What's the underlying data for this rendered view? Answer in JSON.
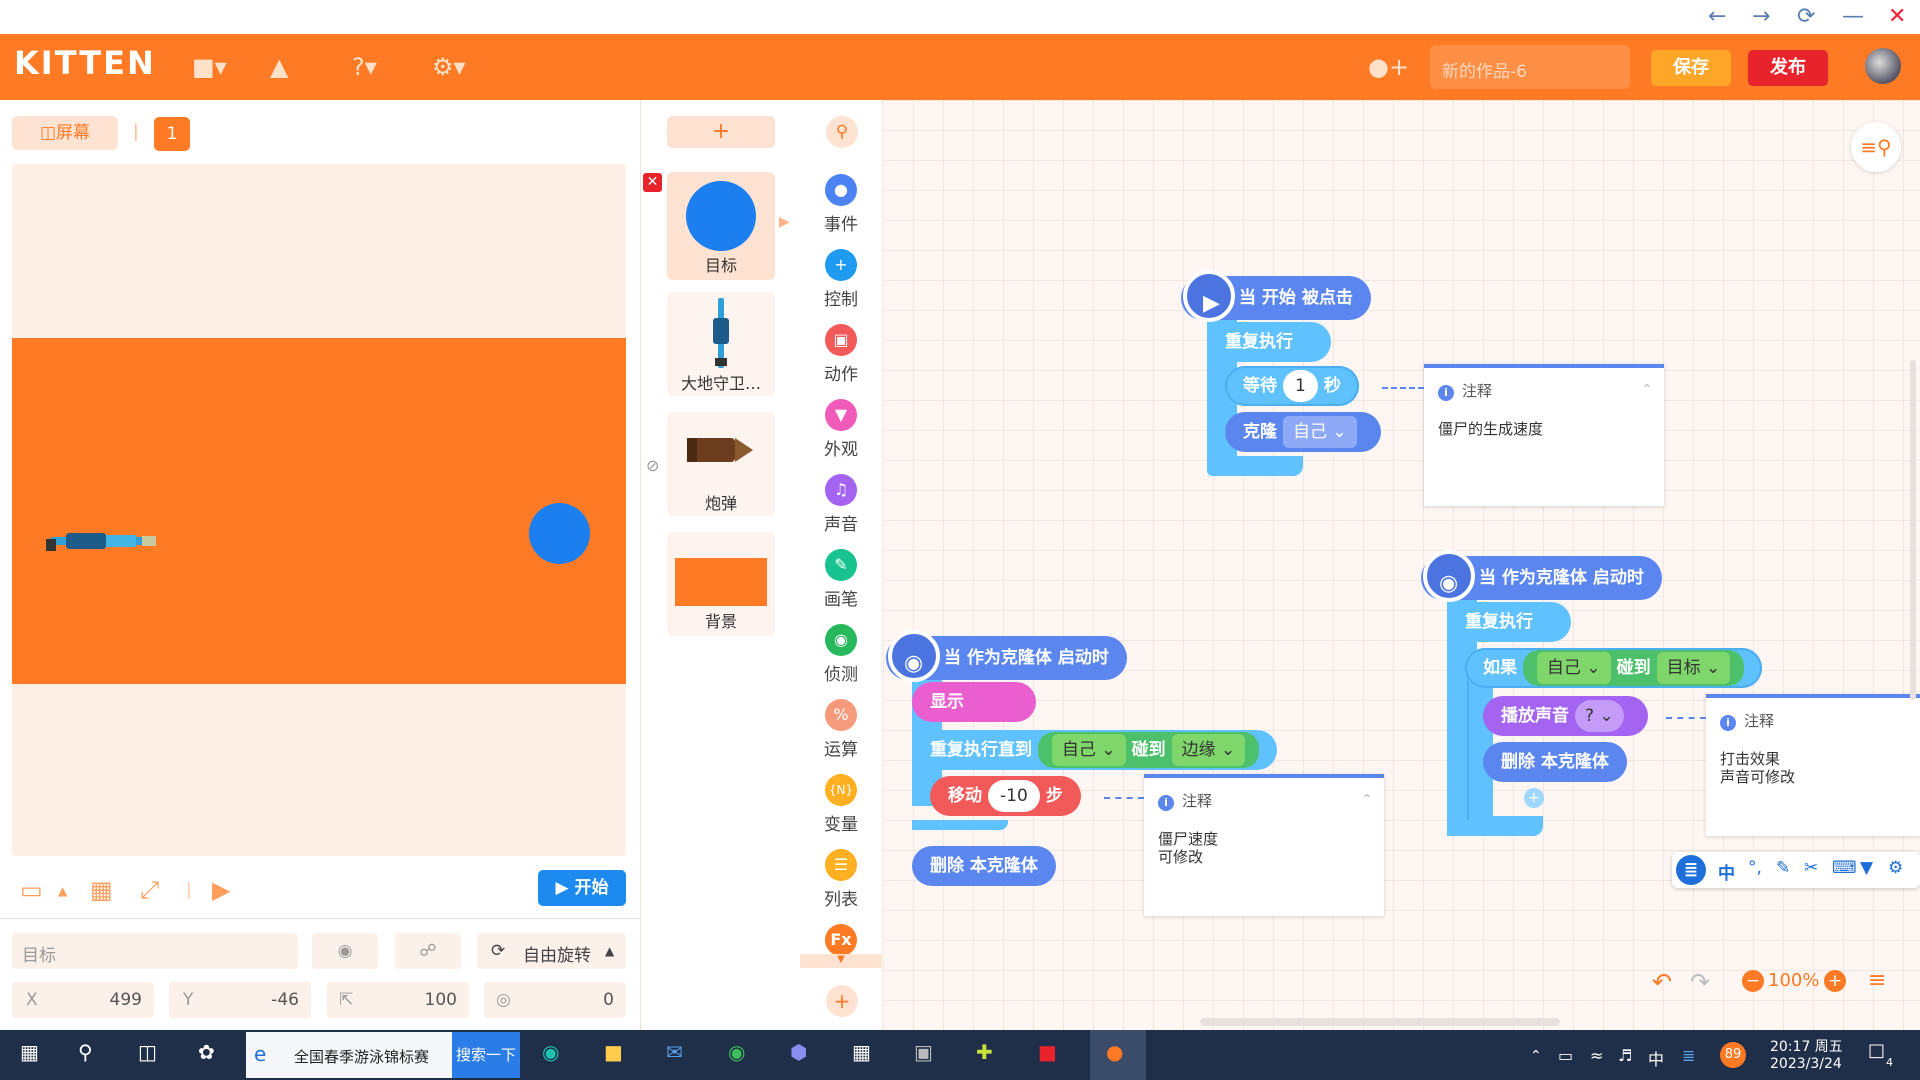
{
  "window": {
    "back": "←",
    "forward": "→",
    "refresh": "⟳",
    "minimize": "—",
    "close": "✕"
  },
  "header": {
    "logo": "KITTEN",
    "project_name": "新的作品-6",
    "save_label": "保存",
    "publish_label": "发布"
  },
  "stage": {
    "screen_label": "屏幕",
    "scene_number": "1",
    "start_label": "开始",
    "sprite_name": "目标",
    "rotation_label": "自由旋转",
    "x_label": "X",
    "x_value": "499",
    "y_label": "Y",
    "y_value": "-46",
    "size_value": "100",
    "direction_value": "0"
  },
  "sprites": {
    "add_label": "+",
    "items": [
      {
        "label": "目标"
      },
      {
        "label": "大地守卫…"
      },
      {
        "label": "炮弹"
      },
      {
        "label": "背景"
      }
    ]
  },
  "categories": [
    {
      "label": "事件",
      "color": "#4b84f2"
    },
    {
      "label": "控制",
      "color": "#1e9af0"
    },
    {
      "label": "动作",
      "color": "#f25a5a"
    },
    {
      "label": "外观",
      "color": "#f05ab8"
    },
    {
      "label": "声音",
      "color": "#a463f0"
    },
    {
      "label": "画笔",
      "color": "#19c38f"
    },
    {
      "label": "侦测",
      "color": "#27b85c"
    },
    {
      "label": "运算",
      "color": "#f59a7a"
    },
    {
      "label": "变量",
      "color": "#ffb020"
    },
    {
      "label": "列表",
      "color": "#ffb020"
    },
    {
      "label": "Fx",
      "color": "#ff7a24"
    }
  ],
  "blocks": {
    "script1": {
      "hat": "当 开始 被点击",
      "forever": "重复执行",
      "wait_a": "等待",
      "wait_value": "1",
      "wait_b": "秒",
      "clone": "克隆",
      "clone_target": "自己"
    },
    "script2": {
      "hat": "当 作为克隆体 启动时",
      "forever": "重复执行",
      "if": "如果",
      "if_a": "自己",
      "if_touch": "碰到",
      "if_b": "目标",
      "sound": "播放声音",
      "sound_value": "?",
      "delete": "删除 本克隆体"
    },
    "script3": {
      "hat": "当 作为克隆体 启动时",
      "show": "显示",
      "repeat_until": "重复执行直到",
      "ru_a": "自己",
      "ru_touch": "碰到",
      "ru_b": "边缘",
      "move": "移动",
      "move_value": "-10",
      "move_unit": "步",
      "delete": "删除 本克隆体"
    }
  },
  "notes": [
    {
      "title": "注释",
      "body": "僵尸的生成速度"
    },
    {
      "title": "注释",
      "body": "打击效果\n声音可修改"
    },
    {
      "title": "注释",
      "body": "僵尸速度\n可修改"
    }
  ],
  "workspace": {
    "zoom": "100%"
  },
  "ime": {
    "lang": "中"
  },
  "taskbar": {
    "browser_tab": "全国春季游泳锦标赛",
    "search_btn": "搜索一下",
    "tray_lang": "中",
    "badge": "89",
    "time": "20:17 周五",
    "date": "2023/3/24",
    "notify_count": "4"
  }
}
